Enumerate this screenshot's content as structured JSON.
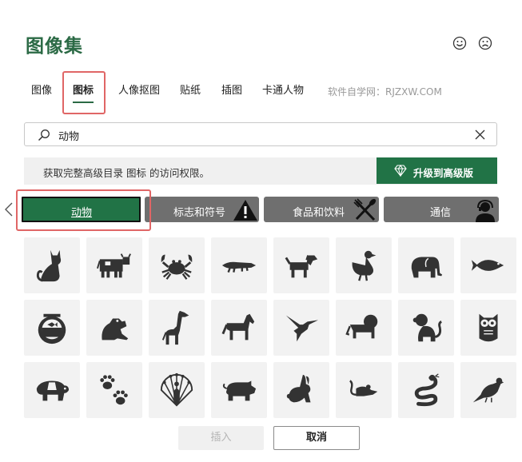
{
  "dialog": {
    "title": "图像集"
  },
  "tabs": [
    {
      "label": "图像"
    },
    {
      "label": "图标"
    },
    {
      "label": "人像抠图"
    },
    {
      "label": "贴纸"
    },
    {
      "label": "插图"
    },
    {
      "label": "卡通人物"
    }
  ],
  "watermark": "软件自学网：RJZXW.COM",
  "search": {
    "value": "动物"
  },
  "banner": {
    "message": "获取完整高级目录 图标 的访问权限。",
    "upgrade_label": "升级到高级版"
  },
  "categories": [
    {
      "label": "动物",
      "icon": "none"
    },
    {
      "label": "标志和符号",
      "icon": "warning-icon"
    },
    {
      "label": "食品和饮料",
      "icon": "fork-knife-icon"
    },
    {
      "label": "通信",
      "icon": "support-agent-icon"
    }
  ],
  "icons": [
    "cat",
    "cow",
    "crab",
    "crocodile",
    "dog",
    "duck",
    "elephant",
    "fish",
    "fishbowl",
    "frog",
    "giraffe",
    "horse",
    "hummingbird",
    "lion",
    "monkey",
    "owl",
    "panda",
    "paw-prints",
    "peacock",
    "pig",
    "rabbit",
    "mouse",
    "snake",
    "bird"
  ],
  "buttons": {
    "insert_label": "插入",
    "cancel_label": "取消"
  },
  "colors": {
    "accent": "#217346",
    "title": "#2b6a45",
    "category_bg": "#6f6f6f",
    "highlight": "#e06666"
  }
}
